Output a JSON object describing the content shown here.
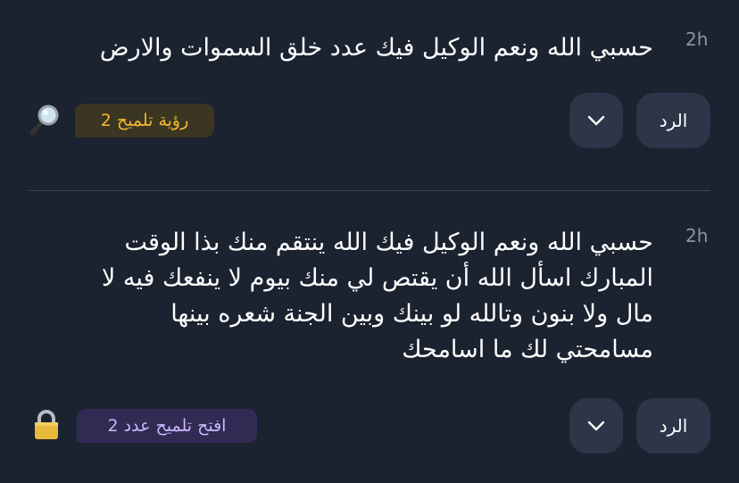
{
  "posts": [
    {
      "time": "2h",
      "text": "حسبي الله ونعم الوكيل فيك عدد خلق السموات والارض",
      "reply_label": "الرد",
      "more_icon": "chevron-down-icon",
      "hint_label": "رؤية تلميح 2",
      "hint_icon": "magnifying-glass-icon",
      "hint_color": "#f5b82e"
    },
    {
      "time": "2h",
      "text_lines": [
        "حسبي الله ونعم الوكيل فيك الله ينتقم منك بذا الوقت",
        "المبارك اسأل الله أن يقتص لي منك بيوم لا ينفعك فيه لا",
        "مال ولا بنون وتالله لو بينك وبين الجنة شعره بينها",
        "مسامحتي لك ما اسامحك"
      ],
      "reply_label": "الرد",
      "more_icon": "chevron-down-icon",
      "hint_label": "افتح تلميح عدد 2",
      "hint_icon": "lock-icon",
      "hint_color": "#c7b8ff"
    }
  ]
}
